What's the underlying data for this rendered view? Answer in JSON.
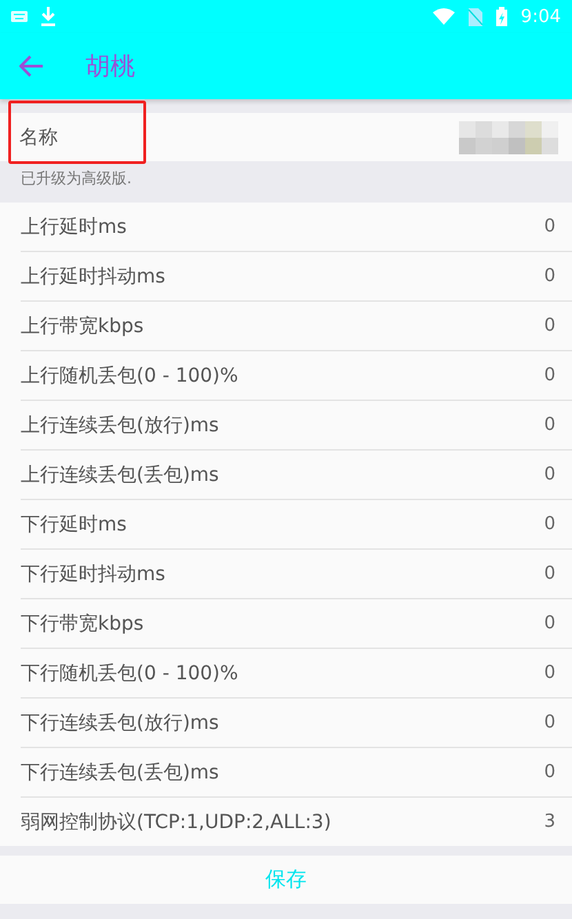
{
  "status_bar": {
    "time": "9:04"
  },
  "toolbar": {
    "title": "胡桃"
  },
  "name_field": {
    "label": "名称",
    "highlighted": true
  },
  "note": "已升级为高级版.",
  "settings": [
    {
      "label": "上行延时ms",
      "value": "0"
    },
    {
      "label": "上行延时抖动ms",
      "value": "0"
    },
    {
      "label": "上行带宽kbps",
      "value": "0"
    },
    {
      "label": "上行随机丢包(0 - 100)%",
      "value": "0"
    },
    {
      "label": "上行连续丢包(放行)ms",
      "value": "0"
    },
    {
      "label": "上行连续丢包(丢包)ms",
      "value": "0"
    },
    {
      "label": "下行延时ms",
      "value": "0"
    },
    {
      "label": "下行延时抖动ms",
      "value": "0"
    },
    {
      "label": "下行带宽kbps",
      "value": "0"
    },
    {
      "label": "下行随机丢包(0 - 100)%",
      "value": "0"
    },
    {
      "label": "下行连续丢包(放行)ms",
      "value": "0"
    },
    {
      "label": "下行连续丢包(丢包)ms",
      "value": "0"
    },
    {
      "label": "弱网控制协议(TCP:1,UDP:2,ALL:3)",
      "value": "3"
    }
  ],
  "save_button": "保存"
}
